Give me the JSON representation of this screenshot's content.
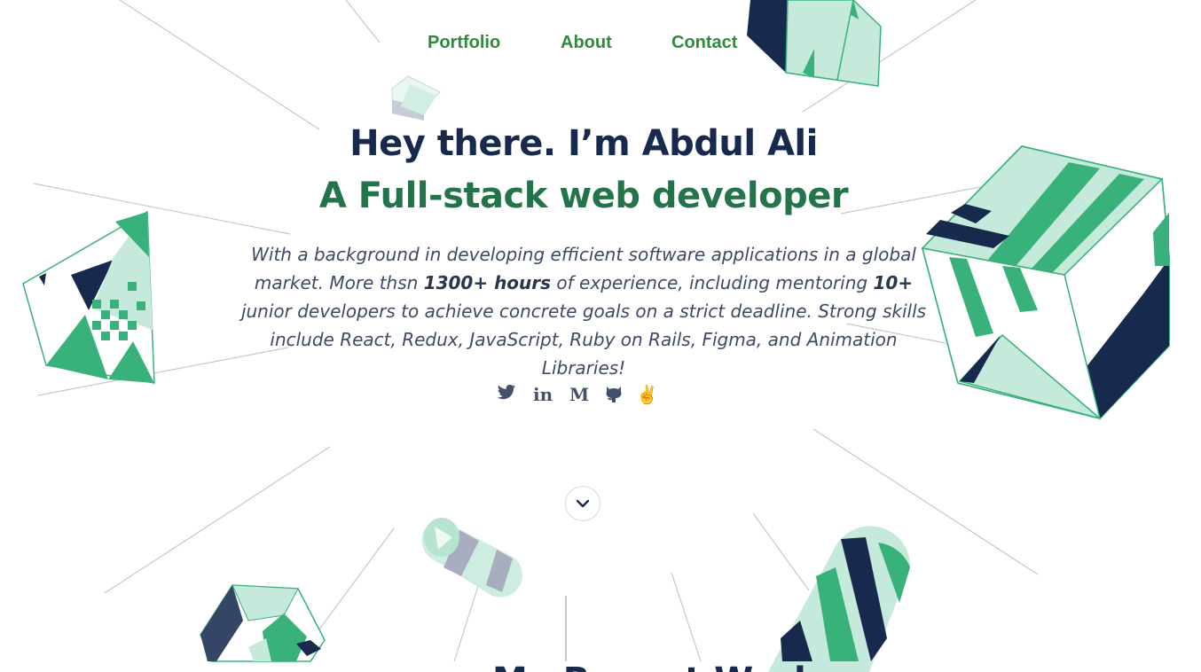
{
  "nav": {
    "links": [
      {
        "label": "Portfolio"
      },
      {
        "label": "About"
      },
      {
        "label": "Contact"
      }
    ]
  },
  "hero": {
    "title": "Hey there. I’m Abdul Ali",
    "subtitle": "A Full-stack web developer",
    "bio": {
      "part1": "With a background in developing efficient software applications in a global market. More thsn ",
      "hours": "1300+ hours",
      "part2": " of experience, including mentoring ",
      "count": "10+",
      "part3": " junior developers to achieve concrete goals on a strict deadline. Strong skills include React, Redux, JavaScript, Ruby on Rails, Figma, and Animation Libraries!"
    }
  },
  "social": {
    "icons": [
      "twitter-icon",
      "linkedin-icon",
      "medium-icon",
      "github-icon",
      "angellist-icon"
    ],
    "linkedin_glyph": "in",
    "medium_glyph": "M",
    "angellist_glyph": "✌"
  },
  "scroll_button": {
    "icon": "chevron-down-icon"
  },
  "next_section": {
    "title": "My Recent Works"
  },
  "colors": {
    "navy": "#172a4e",
    "green": "#38b27a",
    "mint": "#c5eadb",
    "nav_green": "#2f8a3d",
    "subtitle_green": "#24744a"
  }
}
